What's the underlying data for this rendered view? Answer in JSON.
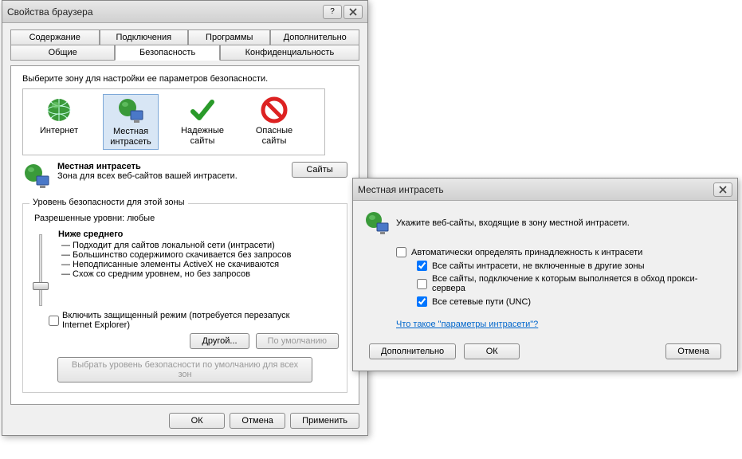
{
  "win1": {
    "title": "Свойства браузера",
    "tabs_row1": [
      "Содержание",
      "Подключения",
      "Программы",
      "Дополнительно"
    ],
    "tabs_row2": [
      "Общие",
      "Безопасность",
      "Конфиденциальность"
    ],
    "zones_label": "Выберите зону для настройки ее параметров безопасности.",
    "zones": [
      {
        "label": "Интернет"
      },
      {
        "label": "Местная интрасеть"
      },
      {
        "label": "Надежные сайты"
      },
      {
        "label": "Опасные сайты"
      }
    ],
    "zoneinfo_title": "Местная интрасеть",
    "zoneinfo_desc": "Зона для всех веб-сайтов вашей интрасети.",
    "sites_button": "Сайты",
    "group_title": "Уровень безопасности для этой зоны",
    "allowed_levels": "Разрешенные уровни: любые",
    "level_name": "Ниже среднего",
    "bullets": [
      "— Подходит для сайтов локальной сети (интрасети)",
      "— Большинство содержимого скачивается без запросов",
      "— Неподписанные элементы ActiveX не скачиваются",
      "— Схож со средним уровнем, но без запросов"
    ],
    "protected_label": "Включить защищенный режим (потребуется перезапуск Internet Explorer)",
    "custom_btn": "Другой...",
    "default_btn": "По умолчанию",
    "reset_btn": "Выбрать уровень безопасности по умолчанию для всех зон",
    "ok": "ОК",
    "cancel": "Отмена",
    "apply": "Применить"
  },
  "win2": {
    "title": "Местная интрасеть",
    "header_text": "Укажите веб-сайты, входящие в зону местной интрасети.",
    "auto_detect": "Автоматически определять принадлежность к интрасети",
    "sub1": "Все сайты интрасети, не включенные в другие зоны",
    "sub2": "Все сайты, подключение к которым выполняется в обход прокси-сервера",
    "sub3": "Все сетевые пути (UNC)",
    "link": "Что такое \"параметры интрасети\"?",
    "advanced": "Дополнительно",
    "ok": "ОК",
    "cancel": "Отмена"
  }
}
